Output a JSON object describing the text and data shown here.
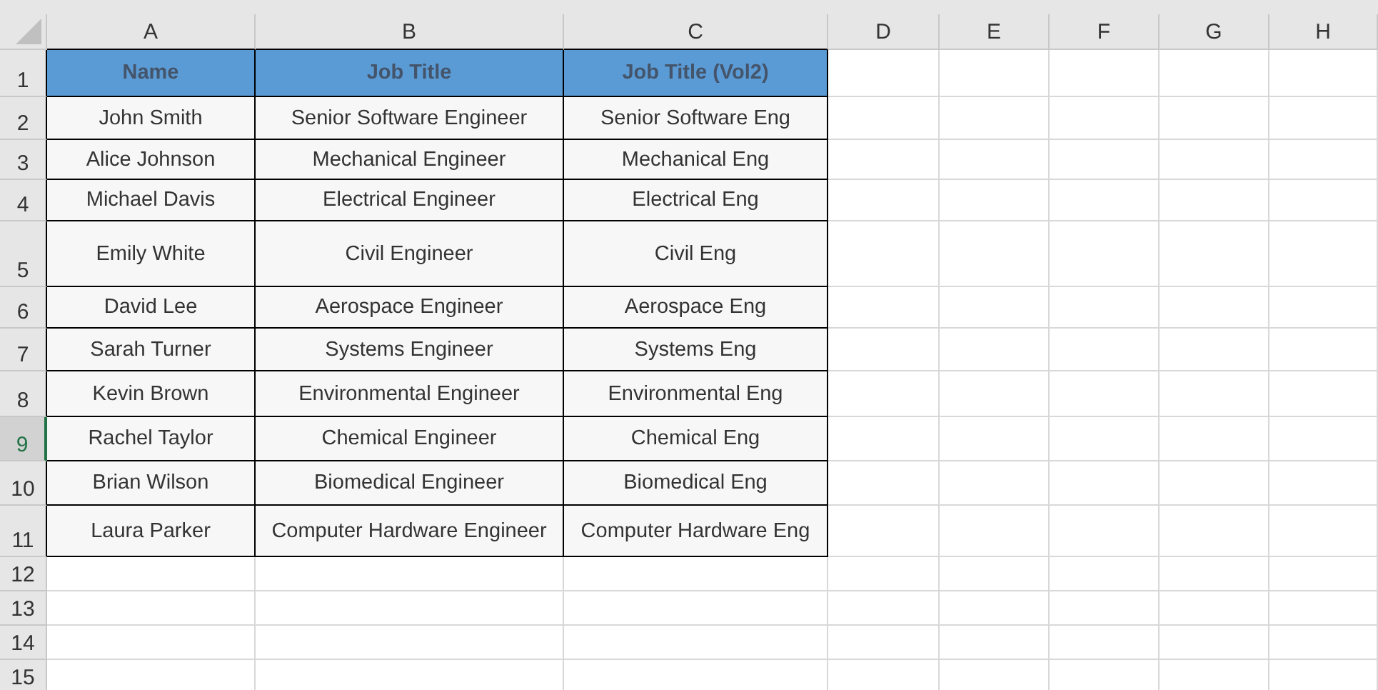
{
  "columns": [
    "A",
    "B",
    "C",
    "D",
    "E",
    "F",
    "G",
    "H"
  ],
  "rows": [
    {
      "number": "1",
      "selected": false,
      "kind": "header",
      "cells": [
        "Name",
        "Job Title",
        "Job Title (Vol2)"
      ]
    },
    {
      "number": "2",
      "selected": false,
      "kind": "data",
      "cells": [
        "John Smith",
        "Senior Software Engineer",
        "Senior Software Eng"
      ]
    },
    {
      "number": "3",
      "selected": false,
      "kind": "data",
      "cells": [
        "Alice Johnson",
        "Mechanical Engineer",
        "Mechanical Eng"
      ]
    },
    {
      "number": "4",
      "selected": false,
      "kind": "data",
      "cells": [
        "Michael Davis",
        "Electrical Engineer",
        "Electrical Eng"
      ]
    },
    {
      "number": "5",
      "selected": false,
      "kind": "data",
      "cells": [
        "Emily White",
        "Civil Engineer",
        "Civil Eng"
      ]
    },
    {
      "number": "6",
      "selected": false,
      "kind": "data",
      "cells": [
        "David Lee",
        "Aerospace Engineer",
        "Aerospace Eng"
      ]
    },
    {
      "number": "7",
      "selected": false,
      "kind": "data",
      "cells": [
        "Sarah Turner",
        "Systems Engineer",
        "Systems Eng"
      ]
    },
    {
      "number": "8",
      "selected": false,
      "kind": "data",
      "cells": [
        "Kevin Brown",
        "Environmental Engineer",
        "Environmental Eng"
      ]
    },
    {
      "number": "9",
      "selected": true,
      "kind": "data",
      "cells": [
        "Rachel Taylor",
        "Chemical Engineer",
        "Chemical Eng"
      ]
    },
    {
      "number": "10",
      "selected": false,
      "kind": "data",
      "cells": [
        "Brian Wilson",
        "Biomedical Engineer",
        "Biomedical Eng"
      ]
    },
    {
      "number": "11",
      "selected": false,
      "kind": "data",
      "cells": [
        "Laura Parker",
        "Computer Hardware Engineer",
        "Computer Hardware Eng"
      ]
    },
    {
      "number": "12",
      "selected": false,
      "kind": "empty",
      "cells": []
    },
    {
      "number": "13",
      "selected": false,
      "kind": "empty",
      "cells": []
    },
    {
      "number": "14",
      "selected": false,
      "kind": "empty",
      "cells": []
    },
    {
      "number": "15",
      "selected": false,
      "kind": "empty",
      "cells": []
    }
  ]
}
